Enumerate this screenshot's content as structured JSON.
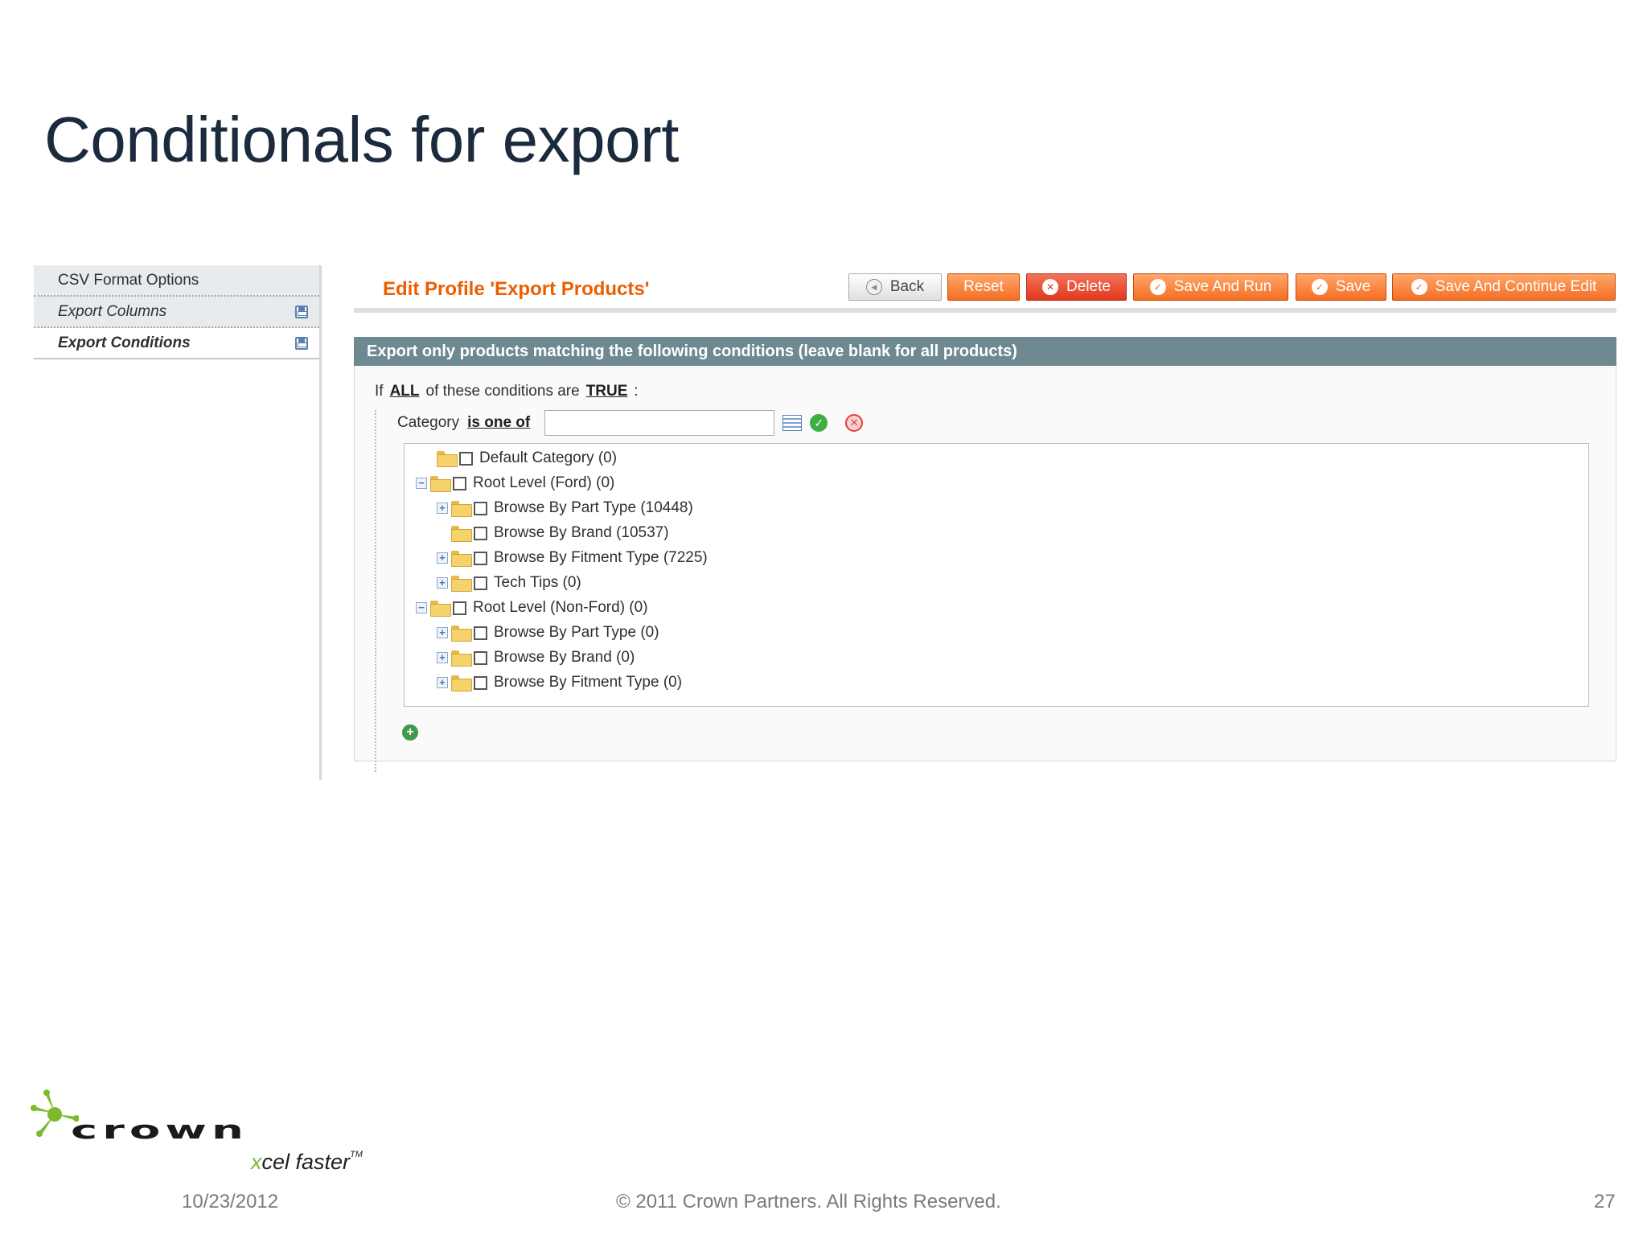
{
  "slide": {
    "title": "Conditionals for export",
    "date": "10/23/2012",
    "copyright": "© 2011 Crown Partners. All Rights Reserved.",
    "page_number": "27"
  },
  "logo": {
    "wordmark": "crown",
    "tagline_x": "x",
    "tagline_rest": "cel faster",
    "trademark": "TM",
    "accent_color": "#7dbb2c"
  },
  "sidebar": {
    "items": [
      {
        "label": "CSV Format Options"
      },
      {
        "label": "Export Columns"
      },
      {
        "label": "Export Conditions"
      }
    ]
  },
  "header": {
    "title": "Edit Profile 'Export Products'",
    "buttons": {
      "back": "Back",
      "reset": "Reset",
      "delete": "Delete",
      "save_and_run": "Save And Run",
      "save": "Save",
      "save_continue": "Save And Continue Edit"
    }
  },
  "conditions": {
    "section_title": "Export only products matching the following conditions (leave blank for all products)",
    "if_text": "If",
    "aggregator": "ALL",
    "middle_text": "of these conditions are",
    "value": "TRUE",
    "colon": ":",
    "attribute_label": "Category",
    "operator": "is one of",
    "value_input": ""
  },
  "tree": [
    {
      "label": "Default Category (0)"
    },
    {
      "label": "Root Level (Ford) (0)"
    },
    {
      "label": "Browse By Part Type (10448)"
    },
    {
      "label": "Browse By Brand (10537)"
    },
    {
      "label": "Browse By Fitment Type (7225)"
    },
    {
      "label": "Tech Tips (0)"
    },
    {
      "label": "Root Level (Non-Ford) (0)"
    },
    {
      "label": "Browse By Part Type (0)"
    },
    {
      "label": "Browse By Brand (0)"
    },
    {
      "label": "Browse By Fitment Type (0)"
    }
  ],
  "colors": {
    "accent_orange": "#f46e23",
    "header_bar": "#6f8992",
    "title_navy": "#1b2a3d"
  }
}
